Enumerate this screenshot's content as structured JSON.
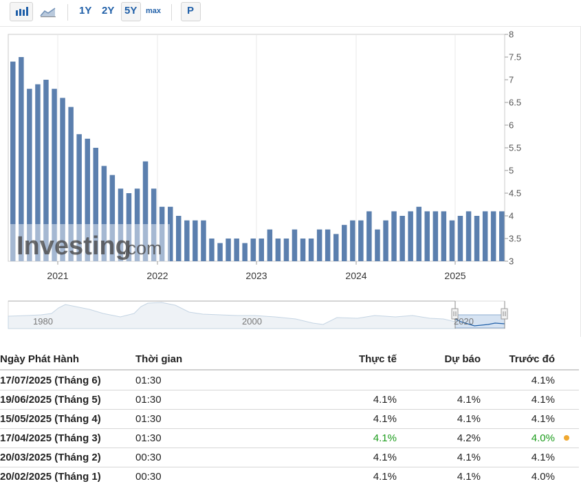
{
  "toolbar": {
    "ranges": [
      "1Y",
      "2Y",
      "5Y",
      "max"
    ],
    "selected_range": "5Y",
    "p_label": "P"
  },
  "watermark": {
    "main": "Investing",
    "suffix": ".com"
  },
  "navigator": {
    "labels": [
      "1980",
      "2000",
      "2020"
    ]
  },
  "colors": {
    "bar": "#5b7fae",
    "positive": "#1c9c1c",
    "dot": "#f0a830"
  },
  "chart_data": {
    "type": "bar",
    "ylim": [
      3,
      8
    ],
    "yticks": [
      3,
      3.5,
      4,
      4.5,
      5,
      5.5,
      6,
      6.5,
      7,
      7.5,
      8
    ],
    "xtick_labels": [
      "2021",
      "2022",
      "2023",
      "2024",
      "2025"
    ],
    "values": [
      7.4,
      7.5,
      6.8,
      6.9,
      7.0,
      6.8,
      6.6,
      6.4,
      5.8,
      5.7,
      5.5,
      5.1,
      4.9,
      4.6,
      4.5,
      4.6,
      5.2,
      4.6,
      4.2,
      4.2,
      4.0,
      3.9,
      3.9,
      3.9,
      3.5,
      3.4,
      3.5,
      3.5,
      3.4,
      3.5,
      3.5,
      3.7,
      3.5,
      3.5,
      3.7,
      3.5,
      3.5,
      3.7,
      3.7,
      3.6,
      3.8,
      3.9,
      3.9,
      4.1,
      3.7,
      3.9,
      4.1,
      4.0,
      4.1,
      4.2,
      4.1,
      4.1,
      4.1,
      3.9,
      4.0,
      4.1,
      4.0,
      4.1,
      4.1,
      4.1
    ],
    "grid": true,
    "legend": "none"
  },
  "table": {
    "headers": {
      "date": "Ngày Phát Hành",
      "time": "Thời gian",
      "actual": "Thực tế",
      "forecast": "Dự báo",
      "previous": "Trước đó"
    },
    "rows": [
      {
        "date": "17/07/2025 (Tháng 6)",
        "time": "01:30",
        "actual": "",
        "forecast": "",
        "previous": "4.1%"
      },
      {
        "date": "19/06/2025 (Tháng 5)",
        "time": "01:30",
        "actual": "4.1%",
        "forecast": "4.1%",
        "previous": "4.1%"
      },
      {
        "date": "15/05/2025 (Tháng 4)",
        "time": "01:30",
        "actual": "4.1%",
        "forecast": "4.1%",
        "previous": "4.1%"
      },
      {
        "date": "17/04/2025 (Tháng 3)",
        "time": "01:30",
        "actual": "4.1%",
        "forecast": "4.2%",
        "previous": "4.0%",
        "highlight": true
      },
      {
        "date": "20/03/2025 (Tháng 2)",
        "time": "00:30",
        "actual": "4.1%",
        "forecast": "4.1%",
        "previous": "4.1%"
      },
      {
        "date": "20/02/2025 (Tháng 1)",
        "time": "00:30",
        "actual": "4.1%",
        "forecast": "4.1%",
        "previous": "4.0%"
      }
    ]
  }
}
